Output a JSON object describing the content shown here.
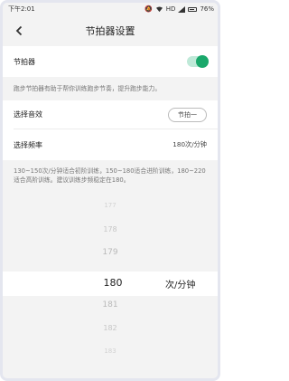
{
  "status_bar": {
    "time": "下午2:01",
    "network": "HD",
    "battery": "76%"
  },
  "nav": {
    "title": "节拍器设置"
  },
  "metronome": {
    "label": "节拍器",
    "enabled": true
  },
  "metronome_desc": "跑步节拍器有助于帮你训练跑步节奏，提升跑步能力。",
  "sound": {
    "label": "选择音效",
    "value": "节拍一"
  },
  "frequency": {
    "label": "选择频率",
    "value": "180次/分钟",
    "desc": "130~150次/分钟适合初阶训练，150~180适合进阶训练，180~220适合高阶训练。建议训练步频稳定在180。"
  },
  "picker": {
    "before": [
      "177",
      "178",
      "179"
    ],
    "selected": "180",
    "unit": "次/分钟",
    "after": [
      "181",
      "182",
      "183"
    ]
  },
  "colors": {
    "accent": "#1aa86b",
    "background": "#f3f3f3"
  }
}
